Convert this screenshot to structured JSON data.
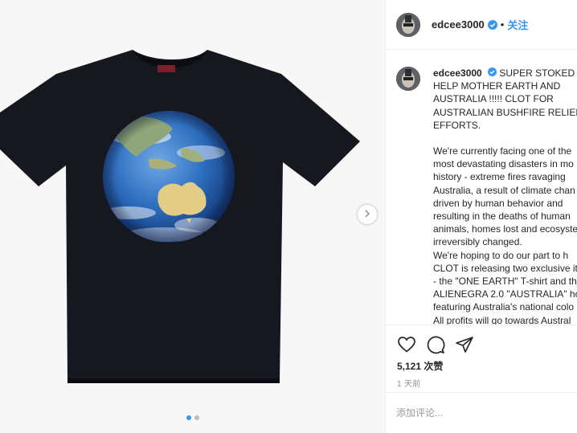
{
  "post": {
    "author": "edcee3000",
    "follow_label": "关注",
    "separator": "•",
    "caption_lines_1": [
      "SUPER STOKED TO",
      "HELP MOTHER EARTH AND",
      "AUSTRALIA !!!!! CLOT FOR",
      "AUSTRALIAN BUSHFIRE RELIEF",
      "EFFORTS."
    ],
    "caption_lines_2": [
      "We're currently facing one of the",
      "most devastating disasters in mo",
      "history - extreme fires ravaging",
      "Australia, a result of climate chan",
      "driven by human behavior and",
      "resulting in the deaths of human",
      "animals, homes lost and ecosyste",
      "irreversibly changed.",
      "We're hoping to do our part to h",
      "CLOT is releasing two exclusive it",
      "- the \"ONE EARTH\" T-shirt and th",
      "ALIENEGRA 2.0 \"AUSTRALIA\" hoo",
      "featuring Australia's national colo",
      "All profits will go towards Austral"
    ],
    "likes": "5,121 次赞",
    "time": "1 天前",
    "comment_placeholder": "添加评论...",
    "carousel": {
      "count": 2,
      "active": 0
    }
  },
  "icons": {
    "verified": "verified-badge-icon",
    "like": "heart-icon",
    "comment": "comment-icon",
    "share": "share-icon",
    "next": "chevron-right-icon"
  },
  "colors": {
    "accent": "#3897f0",
    "shirt": "#16181f",
    "ocean": "#2f6fbf",
    "land": "#e3cc86",
    "muted": "#8e8e8e",
    "border": "#efefef"
  }
}
